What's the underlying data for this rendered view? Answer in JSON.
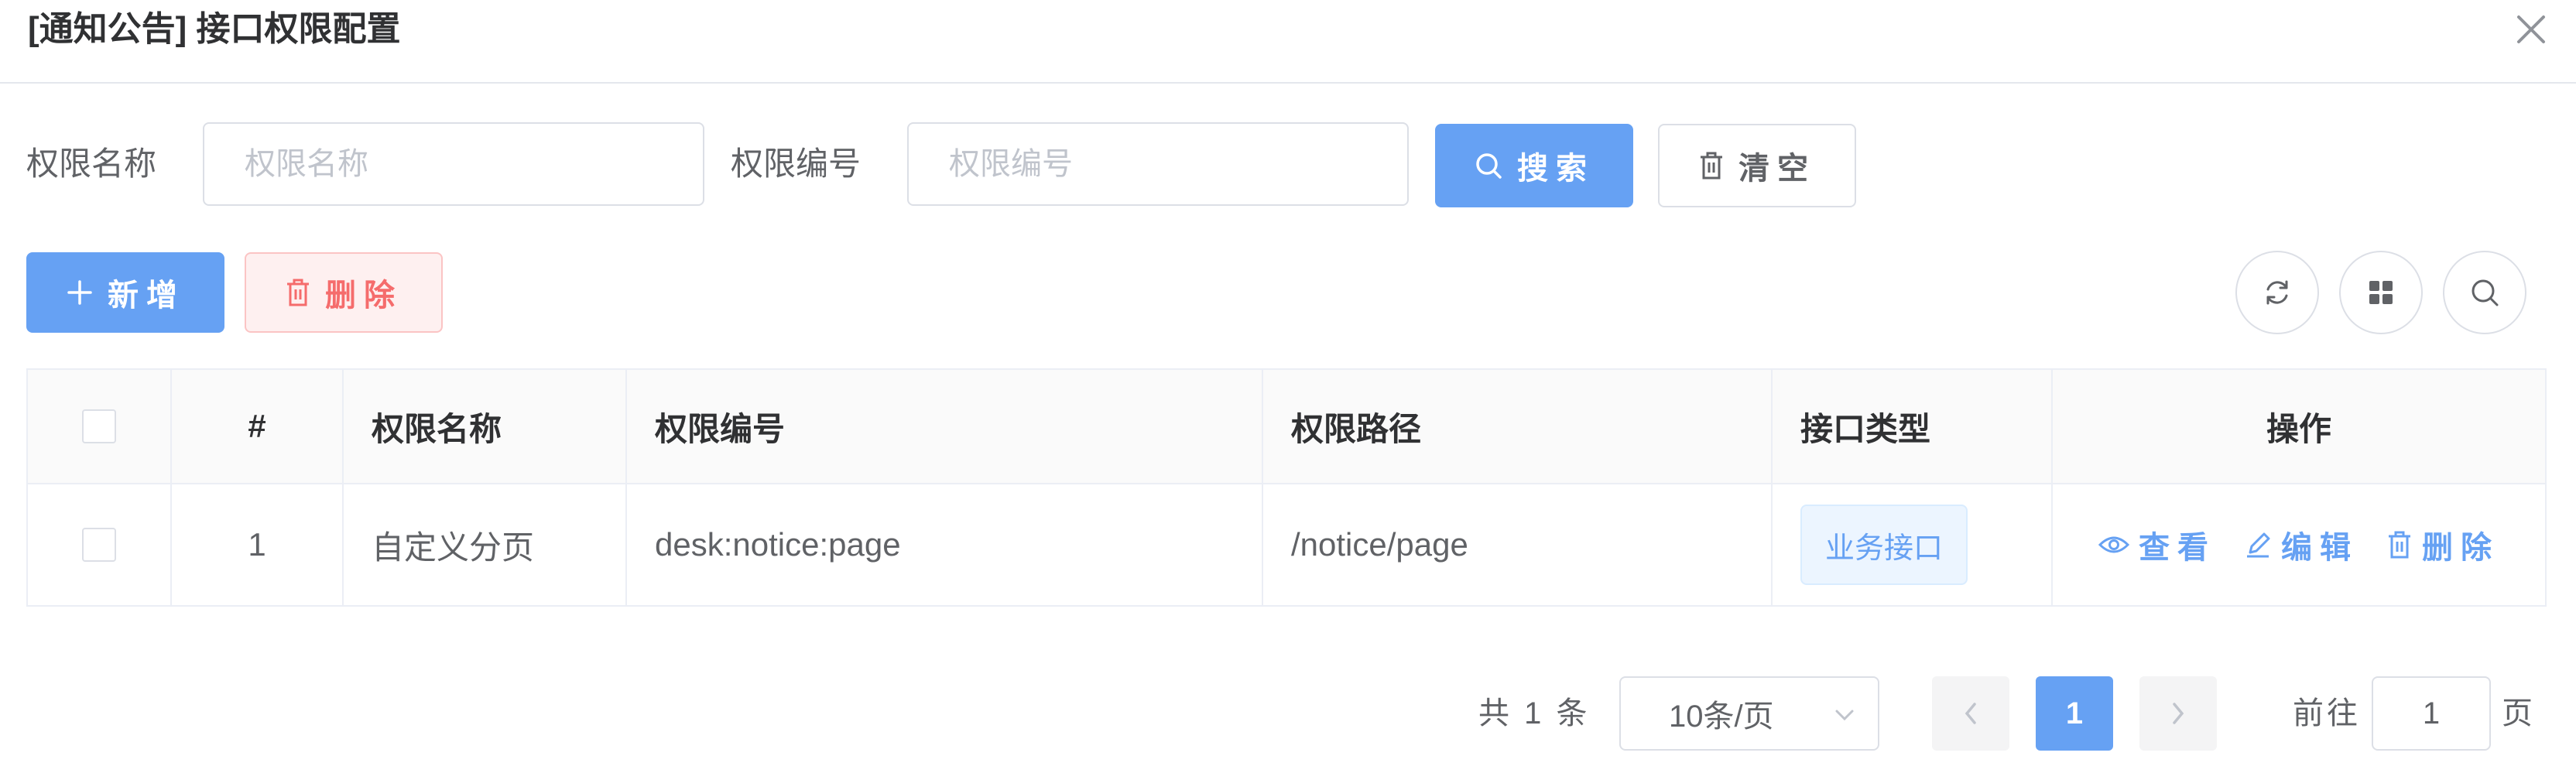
{
  "dialog": {
    "title": "[通知公告] 接口权限配置",
    "close_icon": "close-icon"
  },
  "search": {
    "name_label": "权限名称",
    "name_placeholder": "权限名称",
    "name_value": "",
    "code_label": "权限编号",
    "code_placeholder": "权限编号",
    "code_value": "",
    "search_button": "搜索",
    "clear_button": "清空"
  },
  "toolbar": {
    "add_button": "新增",
    "delete_button": "删除",
    "refresh_icon": "refresh-icon",
    "columns_icon": "grid-icon",
    "search_toggle_icon": "search-icon"
  },
  "table": {
    "columns": {
      "index": "#",
      "name": "权限名称",
      "code": "权限编号",
      "path": "权限路径",
      "type": "接口类型",
      "actions": "操作"
    },
    "rows": [
      {
        "index": "1",
        "name": "自定义分页",
        "code": "desk:notice:page",
        "path": "/notice/page",
        "type": "业务接口",
        "view": "查看",
        "edit": "编辑",
        "delete": "删除"
      }
    ]
  },
  "pagination": {
    "total_text": "共 1 条",
    "page_size": "10条/页",
    "current_page": "1",
    "goto_label": "前往",
    "goto_value": "1",
    "page_suffix": "页"
  },
  "colors": {
    "primary": "#66a1f3",
    "danger": "#f56c6c"
  }
}
